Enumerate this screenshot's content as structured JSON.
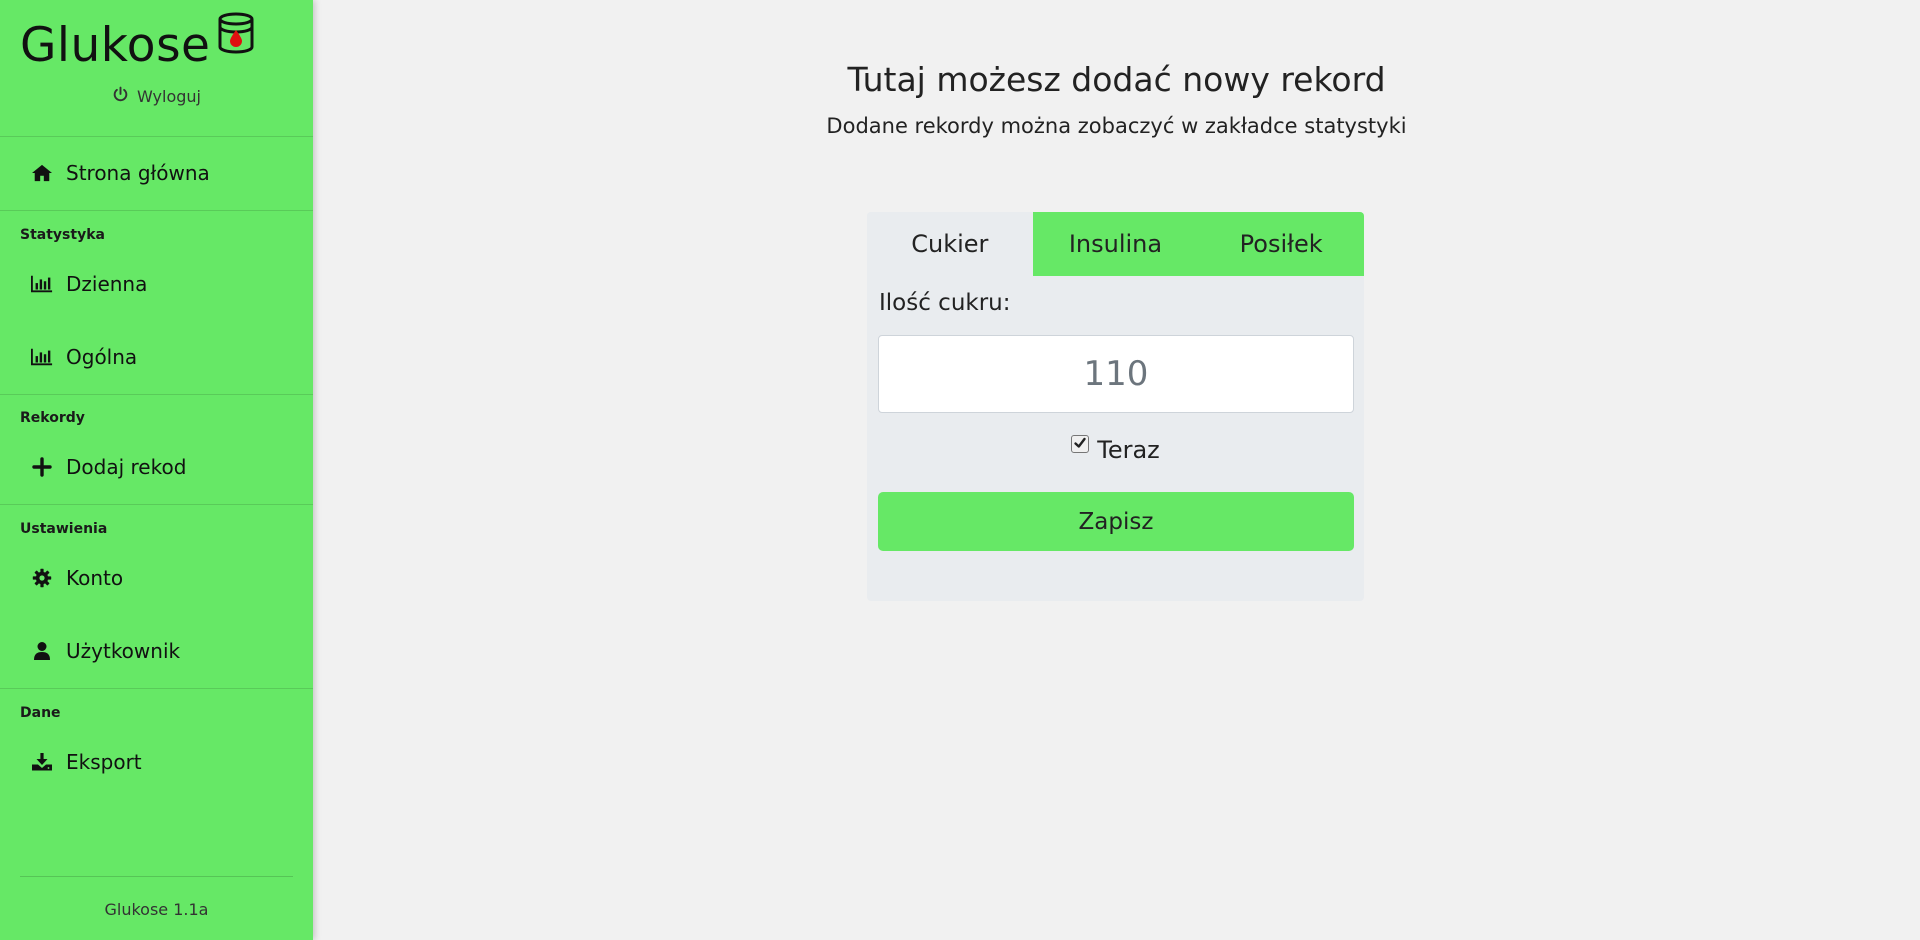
{
  "app": {
    "name": "Glukose",
    "logout_label": "Wyloguj",
    "version": "Glukose 1.1a",
    "accent_color": "#66e866",
    "background_color": "#f1f1f1"
  },
  "sidebar": {
    "home": {
      "label": "Strona główna",
      "icon": "home-icon"
    },
    "sections": [
      {
        "heading": "Statystyka",
        "items": [
          {
            "label": "Dzienna",
            "icon": "bar-chart-icon"
          },
          {
            "label": "Ogólna",
            "icon": "bar-chart-icon"
          }
        ]
      },
      {
        "heading": "Rekordy",
        "items": [
          {
            "label": "Dodaj rekod",
            "icon": "plus-icon"
          }
        ]
      },
      {
        "heading": "Ustawienia",
        "items": [
          {
            "label": "Konto",
            "icon": "gear-icon"
          },
          {
            "label": "Użytkownik",
            "icon": "user-icon"
          }
        ]
      },
      {
        "heading": "Dane",
        "items": [
          {
            "label": "Eksport",
            "icon": "download-icon"
          }
        ]
      }
    ]
  },
  "main": {
    "title": "Tutaj możesz dodać nowy rekord",
    "subtitle": "Dodane rekordy można zobaczyć w zakładce statystyki",
    "tabs": [
      {
        "label": "Cukier",
        "active": true
      },
      {
        "label": "Insulina",
        "active": false
      },
      {
        "label": "Posiłek",
        "active": false
      }
    ],
    "form": {
      "label": "Ilość cukru:",
      "value": "110",
      "now_label": "Teraz",
      "now_checked": true,
      "save_label": "Zapisz"
    }
  }
}
